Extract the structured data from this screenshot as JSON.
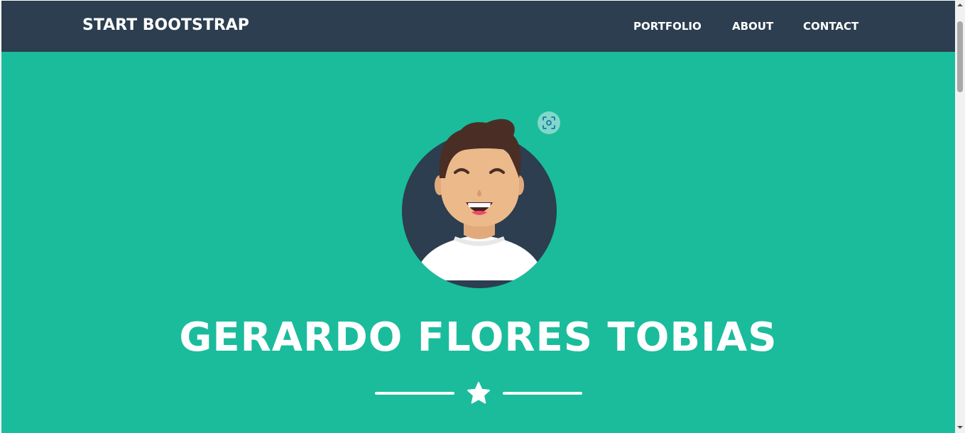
{
  "navbar": {
    "brand": "START BOOTSTRAP",
    "links": [
      "PORTFOLIO",
      "ABOUT",
      "CONTACT"
    ]
  },
  "masthead": {
    "name": "GERARDO FLORES TOBIAS",
    "avatar_icon": "avatar-illustration",
    "divider_icon": "star-icon",
    "overlay_button_icon": "lens-scan-icon"
  },
  "colors": {
    "navbar_bg": "#2c3e50",
    "masthead_bg": "#1abc9c",
    "text": "#ffffff"
  }
}
